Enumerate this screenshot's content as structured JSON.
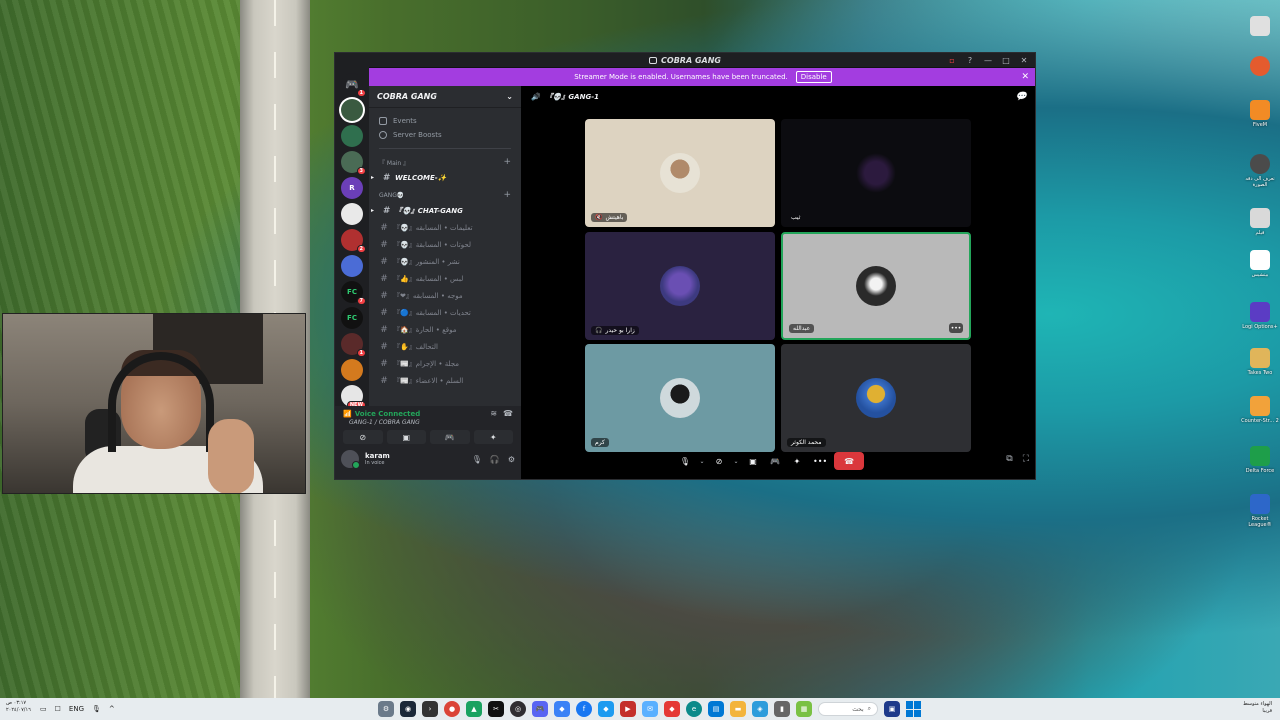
{
  "window": {
    "title": "COBRA GANG",
    "controls": [
      "▫",
      "?",
      "—",
      "□",
      "✕"
    ]
  },
  "streamer_bar": {
    "message": "Streamer Mode is enabled. Usernames have been truncated.",
    "disable_label": "Disable"
  },
  "servers": [
    {
      "letter": "",
      "badge": "1"
    },
    {
      "letter": "",
      "badge": ""
    },
    {
      "letter": "",
      "badge": ""
    },
    {
      "letter": "",
      "badge": "3"
    },
    {
      "letter": "R",
      "badge": ""
    },
    {
      "letter": "",
      "badge": ""
    },
    {
      "letter": "",
      "badge": "2"
    },
    {
      "letter": "",
      "badge": ""
    },
    {
      "letter": "FC",
      "badge": "7"
    },
    {
      "letter": "FC",
      "badge": ""
    },
    {
      "letter": "",
      "badge": "1"
    },
    {
      "letter": "",
      "badge": ""
    },
    {
      "letter": "",
      "badge": "NEW"
    }
  ],
  "sidebar": {
    "server_name": "COBRA GANG",
    "events_label": "Events",
    "boosts_label": "Server Boosts",
    "categories": [
      {
        "name": "『 Main 』",
        "channels": [
          {
            "name": "WELCOME-✨",
            "bold": true
          }
        ]
      },
      {
        "name": "GANG💀",
        "channels": [
          {
            "name": "『💀』CHAT-GANG",
            "bold": true
          },
          {
            "name": "『💀』تعليمات • المسابقه",
            "bold": false
          },
          {
            "name": "『💀』لحوتات • المسابقة",
            "bold": false
          },
          {
            "name": "『💀』نشر • المنشور",
            "bold": false
          },
          {
            "name": "『👍』لبس • المسابقه",
            "bold": false
          },
          {
            "name": "『❤』موجه • المسابقه",
            "bold": false
          },
          {
            "name": "『🔵』تحديات • المسابقه",
            "bold": false
          },
          {
            "name": "『🏠』موقع • الحارة",
            "bold": false
          },
          {
            "name": "『✋』التحالف",
            "bold": false
          },
          {
            "name": "『📰』مجلة • الإجرام",
            "bold": false
          },
          {
            "name": "『📰』السلم • الاعضاء",
            "bold": false
          }
        ]
      }
    ]
  },
  "voice": {
    "status": "Voice Connected",
    "channel": "GANG-1 / COBRA GANG",
    "user": "karam",
    "user_status": "In voice"
  },
  "stage": {
    "channel_name": "『💀』GANG-1",
    "tiles": [
      {
        "name": "باهيتش"
      },
      {
        "name": "ثيب"
      },
      {
        "name": "زارا بو حيدر"
      },
      {
        "name": "عبدالله"
      },
      {
        "name": "كرم"
      },
      {
        "name": "محمد الكوثر"
      }
    ]
  },
  "desktop_icons": [
    {
      "label": "",
      "color": "#e0e0e0"
    },
    {
      "label": "",
      "color": "#e45b2e"
    },
    {
      "label": "FiveM",
      "color": "#f28b25"
    },
    {
      "label": "تعرف الى دقه الصورة",
      "color": "#4b4b4b"
    },
    {
      "label": "فيلم",
      "color": "#d9d9d9"
    },
    {
      "label": "بيتشيس",
      "color": "#ffffff"
    },
    {
      "label": "Logi Options+",
      "color": "#5b3cc4"
    },
    {
      "label": "Takes Two",
      "color": "#e0b55a"
    },
    {
      "label": "Counter-Str... 2",
      "color": "#f2a23a"
    },
    {
      "label": "Delta Force",
      "color": "#1e9e4a"
    },
    {
      "label": "Rocket League®",
      "color": "#2d67c9"
    }
  ],
  "taskbar": {
    "time": "٠٣:١٧ ص",
    "date": "٢٠٢٤/٠٧/١٦",
    "lang": "ENG",
    "search_placeholder": "بحث",
    "weather": "الهواء متوسط",
    "weather_sub": "قريبا"
  }
}
